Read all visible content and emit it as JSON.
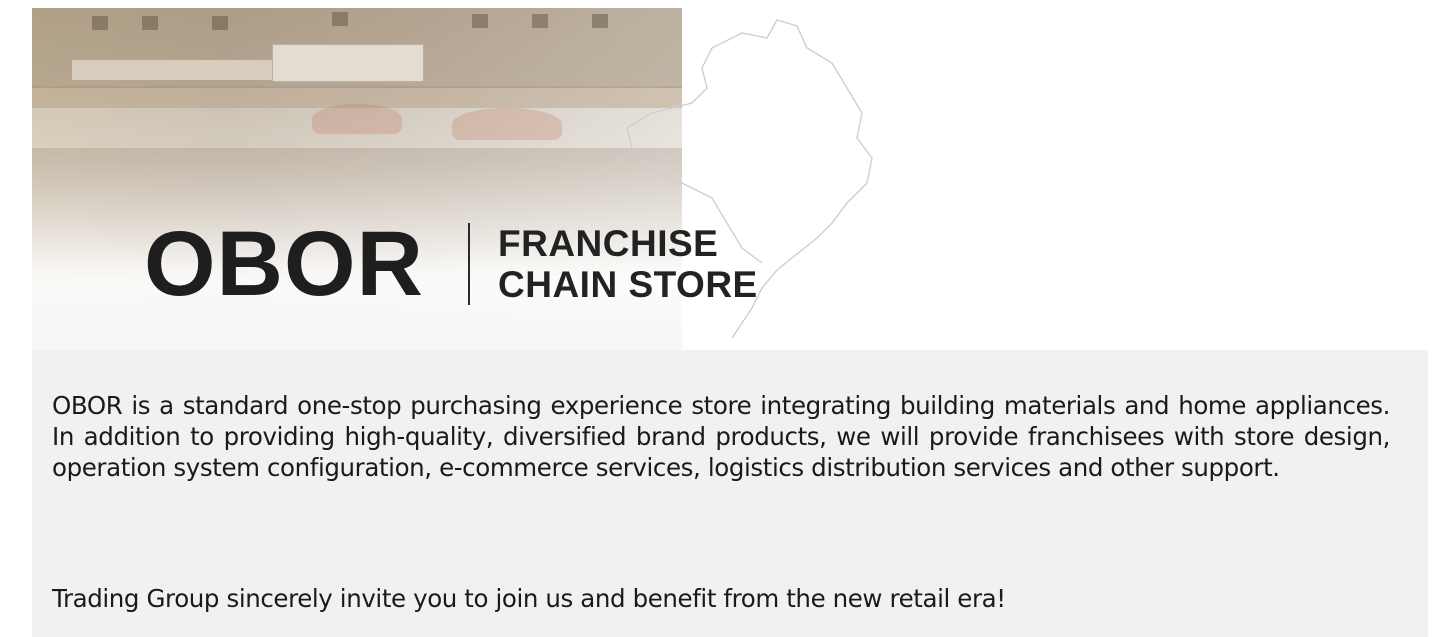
{
  "hero": {
    "logo_main": "OBOR",
    "logo_sub_line1": "FRANCHISE",
    "logo_sub_line2": "CHAIN STORE"
  },
  "content": {
    "description": "OBOR is a standard one-stop purchasing experience store integrating building materials and home appliances. In addition to providing high-quality, diversified brand products, we will provide franchisees with store design, operation system configuration, e-commerce services, logistics distribution services and other support.",
    "invitation": "Trading Group sincerely invite you to join us and benefit from the new retail era!"
  },
  "colors": {
    "logo_text": "#1e1e1e",
    "panel_background": "#f1f1ef",
    "body_text": "#1a1a1a"
  }
}
